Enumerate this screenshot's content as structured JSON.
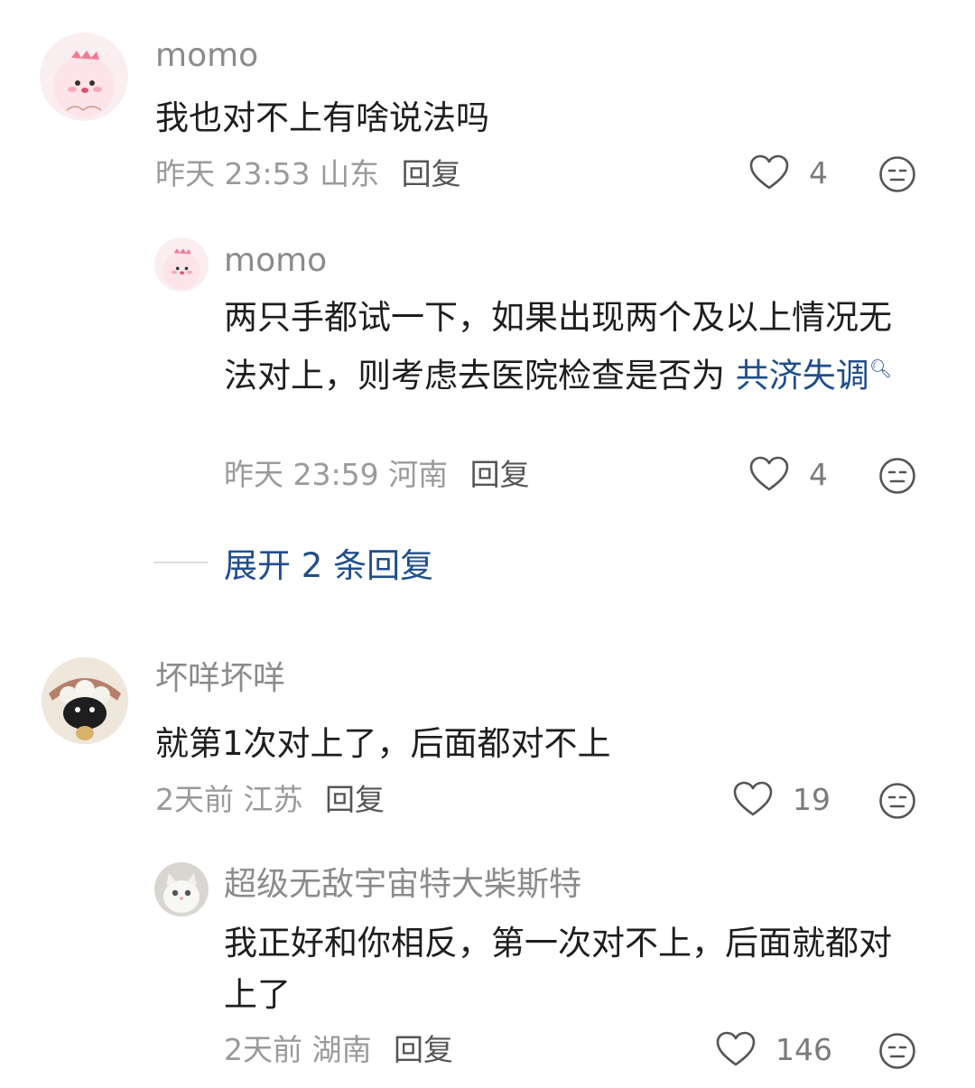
{
  "comments": [
    {
      "username": "momo",
      "text": "我也对不上有啥说法吗",
      "time": "昨天 23:53",
      "location": "山东",
      "reply_label": "回复",
      "likes": "4",
      "avatar_icon": "pink-dinosaur-avatar",
      "replies": [
        {
          "username": "momo",
          "text_plain": "两只手都试一下，如果出现两个及以上情况无法对上，则考虑去医院检查是否为",
          "link_text": "共济失调",
          "time": "昨天 23:59",
          "location": "河南",
          "reply_label": "回复",
          "likes": "4",
          "avatar_icon": "pink-dinosaur-avatar"
        }
      ],
      "expand_label": "展开 2 条回复"
    },
    {
      "username": "坏咩坏咩",
      "text": "就第1次对上了，后面都对不上",
      "time": "2天前",
      "location": "江苏",
      "reply_label": "回复",
      "likes": "19",
      "avatar_icon": "sheep-avatar",
      "replies": [
        {
          "username": "超级无敌宇宙特大柴斯特",
          "text_plain": "我正好和你相反，第一次对不上，后面就都对上了",
          "time": "2天前",
          "location": "湖南",
          "reply_label": "回复",
          "likes": "146",
          "avatar_icon": "white-cat-avatar"
        }
      ]
    }
  ],
  "colors": {
    "username": "#8b8b8b",
    "link": "#1f4e8c",
    "meta": "#9a9a9a"
  }
}
